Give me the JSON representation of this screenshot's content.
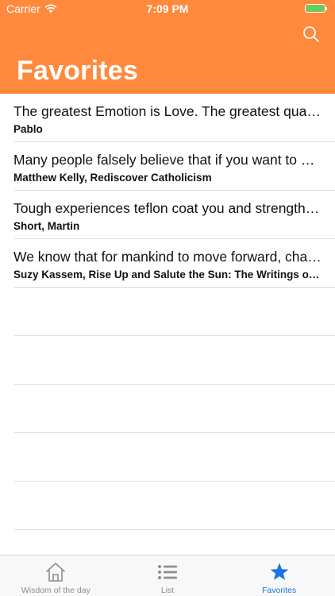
{
  "status_bar": {
    "carrier": "Carrier",
    "time": "7:09 PM"
  },
  "header": {
    "title": "Favorites",
    "search_icon": "search-icon"
  },
  "favorites": [
    {
      "quote": "The greatest Emotion is Love. The greatest quality is Compassion.",
      "author": "Pablo"
    },
    {
      "quote": "Many people falsely believe that if you want to be happy you must follow your passions.",
      "author": "Matthew Kelly, Rediscover Catholicism"
    },
    {
      "quote": "Tough experiences teflon coat you and strengthen you.",
      "author": "Short, Martin"
    },
    {
      "quote": "We know that for mankind to move forward, change must happen.",
      "author": "Suzy Kassem, Rise Up and Salute the Sun: The Writings of Suzy Kassem"
    }
  ],
  "tabbar": {
    "tabs": [
      {
        "label": "Wisdom of the day",
        "icon": "home-icon"
      },
      {
        "label": "List",
        "icon": "list-icon"
      },
      {
        "label": "Favorites",
        "icon": "star-icon"
      }
    ],
    "active_color": "#1a73e8",
    "inactive_color": "#8e8e93"
  },
  "colors": {
    "header": "#ff8a3d",
    "battery": "#4cd964"
  }
}
